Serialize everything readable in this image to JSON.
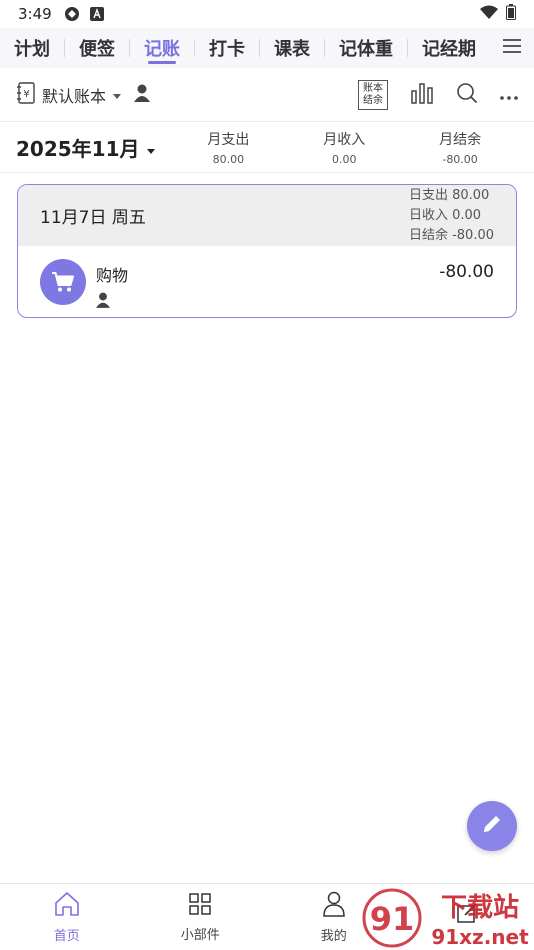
{
  "status_bar": {
    "time": "3:49"
  },
  "tabs": [
    {
      "label": "计划",
      "active": false
    },
    {
      "label": "便签",
      "active": false
    },
    {
      "label": "记账",
      "active": true
    },
    {
      "label": "打卡",
      "active": false
    },
    {
      "label": "课表",
      "active": false
    },
    {
      "label": "记体重",
      "active": false
    },
    {
      "label": "记经期",
      "active": false
    }
  ],
  "toolbar": {
    "book_label": "默认账本",
    "balance_btn_line1": "账本",
    "balance_btn_line2": "结余"
  },
  "month_summary": {
    "month": "2025年11月",
    "expense_label": "月支出",
    "expense_value": "80.00",
    "income_label": "月收入",
    "income_value": "0.00",
    "balance_label": "月结余",
    "balance_value": "-80.00"
  },
  "day": {
    "title": "11月7日 周五",
    "expense": "日支出 80.00",
    "income": "日收入 0.00",
    "balance": "日结余 -80.00",
    "entries": [
      {
        "name": "购物",
        "amount": "-80.00",
        "icon": "shopping-cart-icon"
      }
    ]
  },
  "bottom_nav": [
    {
      "label": "首页",
      "icon": "home-icon",
      "active": true
    },
    {
      "label": "小部件",
      "icon": "widgets-icon",
      "active": false
    },
    {
      "label": "我的",
      "icon": "profile-icon",
      "active": false
    },
    {
      "label": "",
      "icon": "edit-icon",
      "active": false
    }
  ],
  "watermark": {
    "text_top": "下载站",
    "text_bottom": "91xz.net",
    "digits": "91"
  },
  "colors": {
    "accent": "#7b72e0",
    "card_border": "#8c85e6",
    "fab": "#8b84e8",
    "watermark": "#c8232c"
  }
}
